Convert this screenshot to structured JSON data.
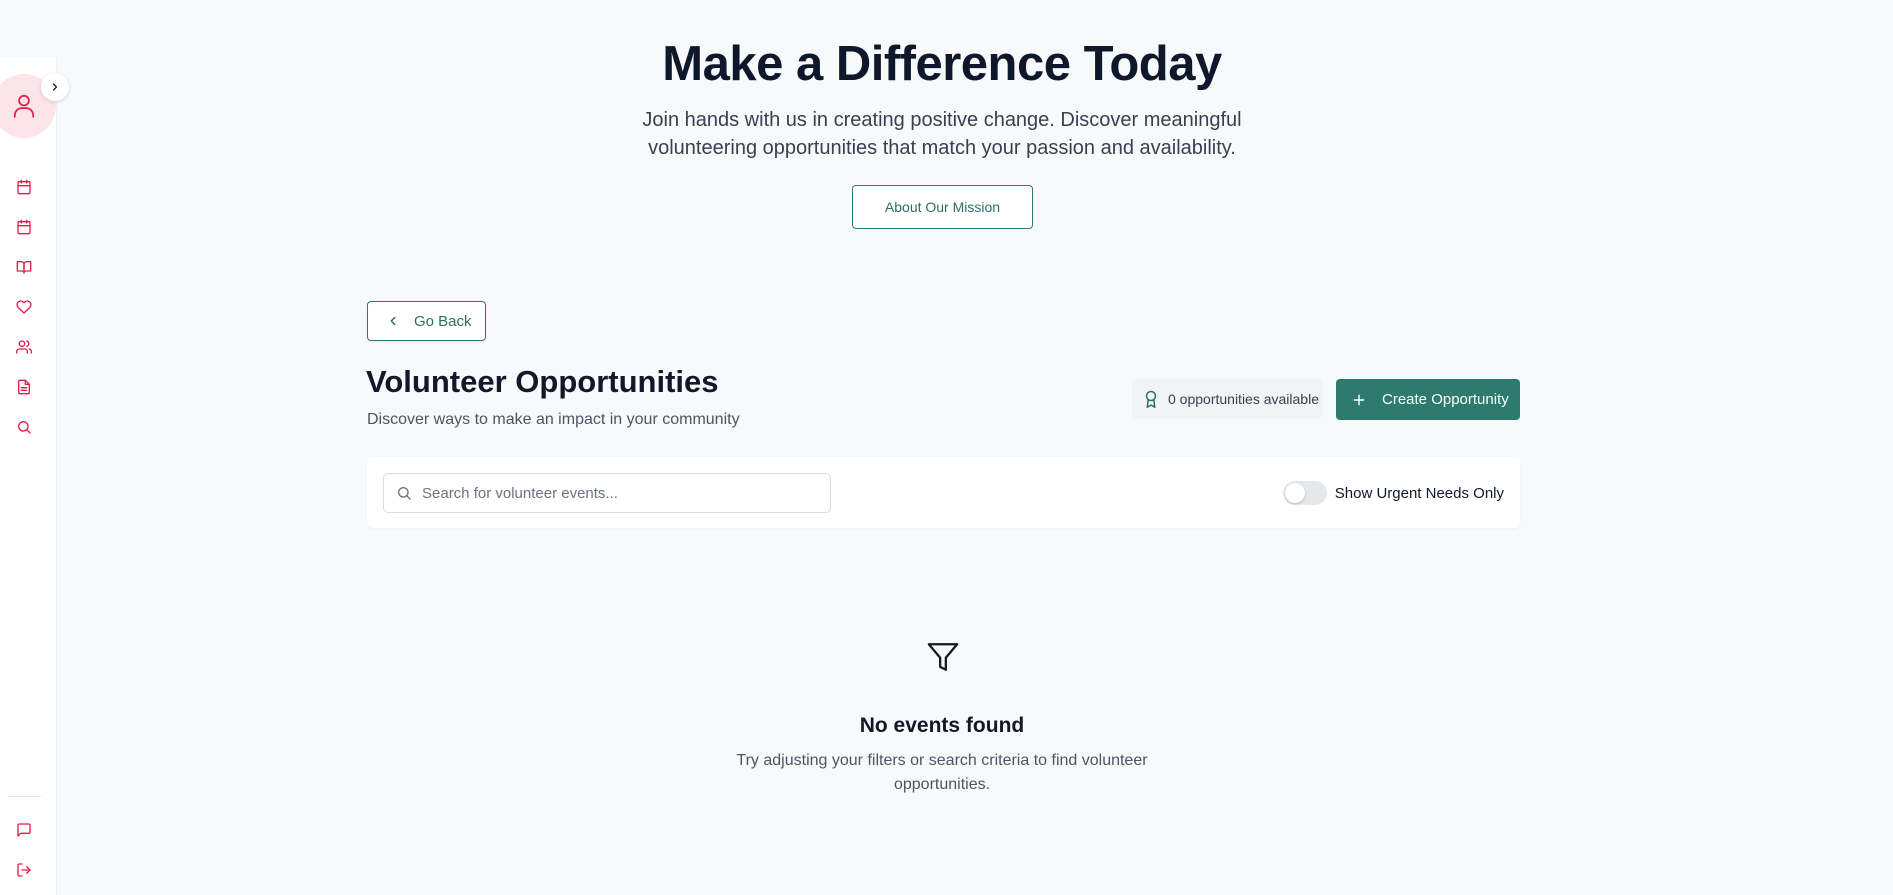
{
  "hero": {
    "title": "Make a Difference Today",
    "subtitle": "Join hands with us in creating positive change. Discover meaningful volunteering opportunities that match your passion and availability.",
    "mission_button": "About Our Mission"
  },
  "nav": {
    "back_label": "Go Back"
  },
  "section": {
    "title": "Volunteer Opportunities",
    "subtitle": "Discover ways to make an impact in your community",
    "count_label": "0 opportunities available",
    "create_label": "Create Opportunity"
  },
  "filters": {
    "search_placeholder": "Search for volunteer events...",
    "search_value": "",
    "urgent_label": "Show Urgent Needs Only",
    "urgent_on": false
  },
  "empty_state": {
    "title": "No events found",
    "message": "Try adjusting your filters or search criteria to find volunteer opportunities."
  },
  "sidebar": {
    "items": [
      "calendar-icon",
      "calendar-icon",
      "book-open-icon",
      "heart-icon",
      "users-icon",
      "file-text-icon",
      "search-icon"
    ],
    "bottom_items": [
      "message-icon",
      "logout-icon"
    ]
  },
  "colors": {
    "accent": "#2d7a6e",
    "sidebar_icon": "#e11d48",
    "avatar_bg": "#fde4e8",
    "background": "#f8f9fb"
  }
}
